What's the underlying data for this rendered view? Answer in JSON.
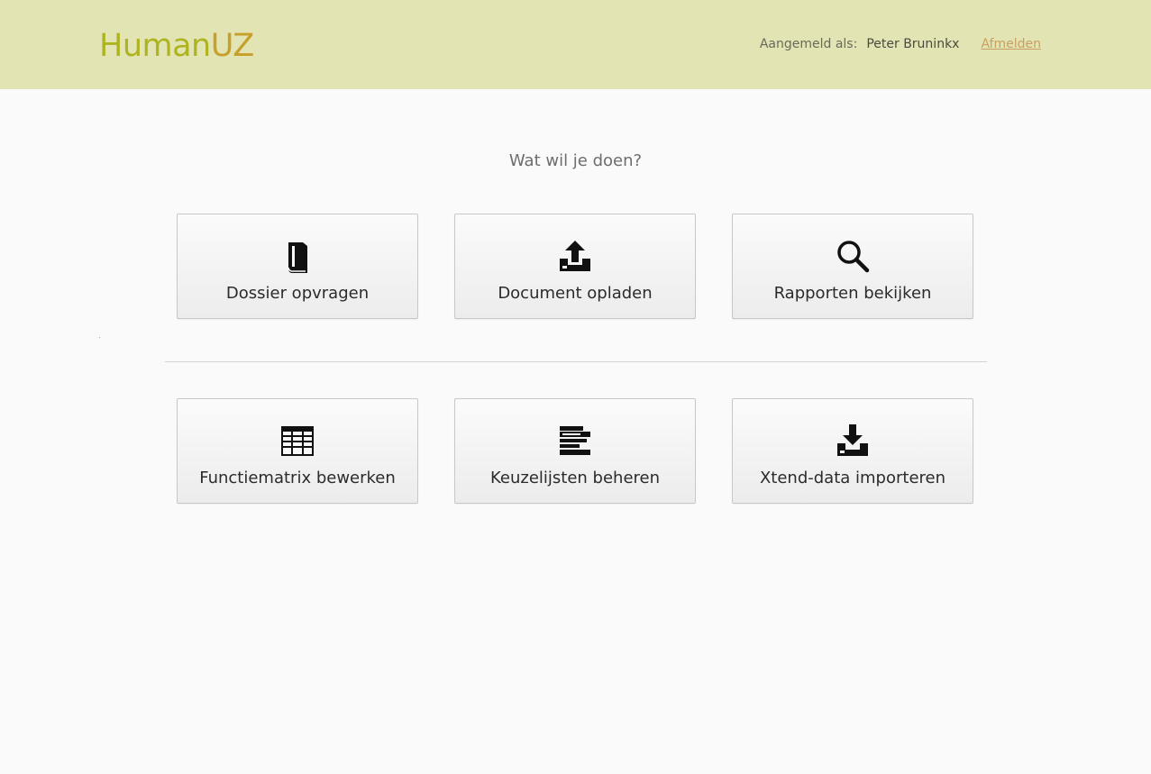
{
  "header": {
    "logo_part1": "Human",
    "logo_part2": "UZ",
    "user_label": "Aangemeld als:",
    "user_name": "Peter Bruninkx",
    "logout": "Afmelden"
  },
  "main": {
    "prompt": "Wat wil je doen?",
    "tiles_top": [
      {
        "label": "Dossier opvragen",
        "icon": "book-icon"
      },
      {
        "label": "Document opladen",
        "icon": "upload-icon"
      },
      {
        "label": "Rapporten bekijken",
        "icon": "search-icon"
      }
    ],
    "tiles_bottom": [
      {
        "label": "Functiematrix bewerken",
        "icon": "table-icon"
      },
      {
        "label": "Keuzelijsten beheren",
        "icon": "list-icon"
      },
      {
        "label": "Xtend-data importeren",
        "icon": "download-icon"
      }
    ]
  },
  "colors": {
    "header_bg": "#e3e4b4",
    "logo_primary": "#aeb41f",
    "logo_accent": "#c79f2b",
    "link": "#c7a05f"
  }
}
